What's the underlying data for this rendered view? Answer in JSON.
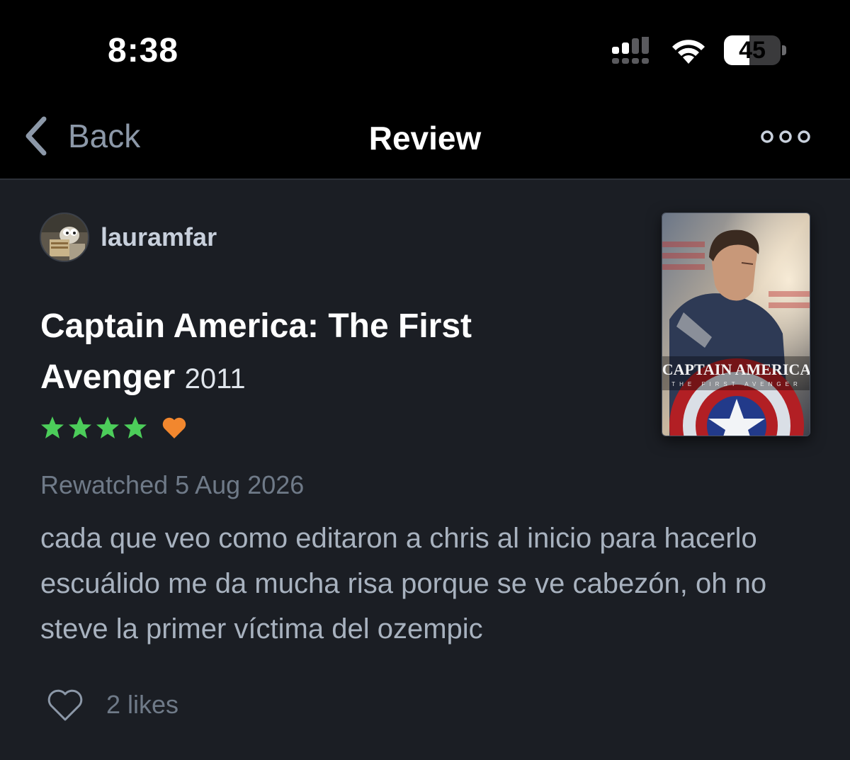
{
  "status_bar": {
    "time": "8:38",
    "battery": "45",
    "battery_level_percent": 45
  },
  "nav": {
    "back_label": "Back",
    "title": "Review",
    "more_icon": "ellipsis-icon"
  },
  "review": {
    "author": "lauramfar",
    "film_title": "Captain America: The First Avenger",
    "film_year": "2011",
    "rating_stars": 4,
    "liked": true,
    "watch_date": "Rewatched 5 Aug 2026",
    "text": "cada que veo como editaron a chris al inicio para hacerlo escuálido me da mucha risa porque se ve cabezón, oh no steve la primer víctima del ozempic",
    "likes": "2 likes"
  },
  "poster": {
    "title": "CAPTAIN AMERICA",
    "subtitle": "THE FIRST AVENGER"
  },
  "colors": {
    "background": "#1b1e24",
    "bars": "#000000",
    "star_green": "#4ccd5a",
    "heart_orange": "#f2872e",
    "muted_text": "#6f7a88",
    "body_text": "#a8b2bf"
  }
}
